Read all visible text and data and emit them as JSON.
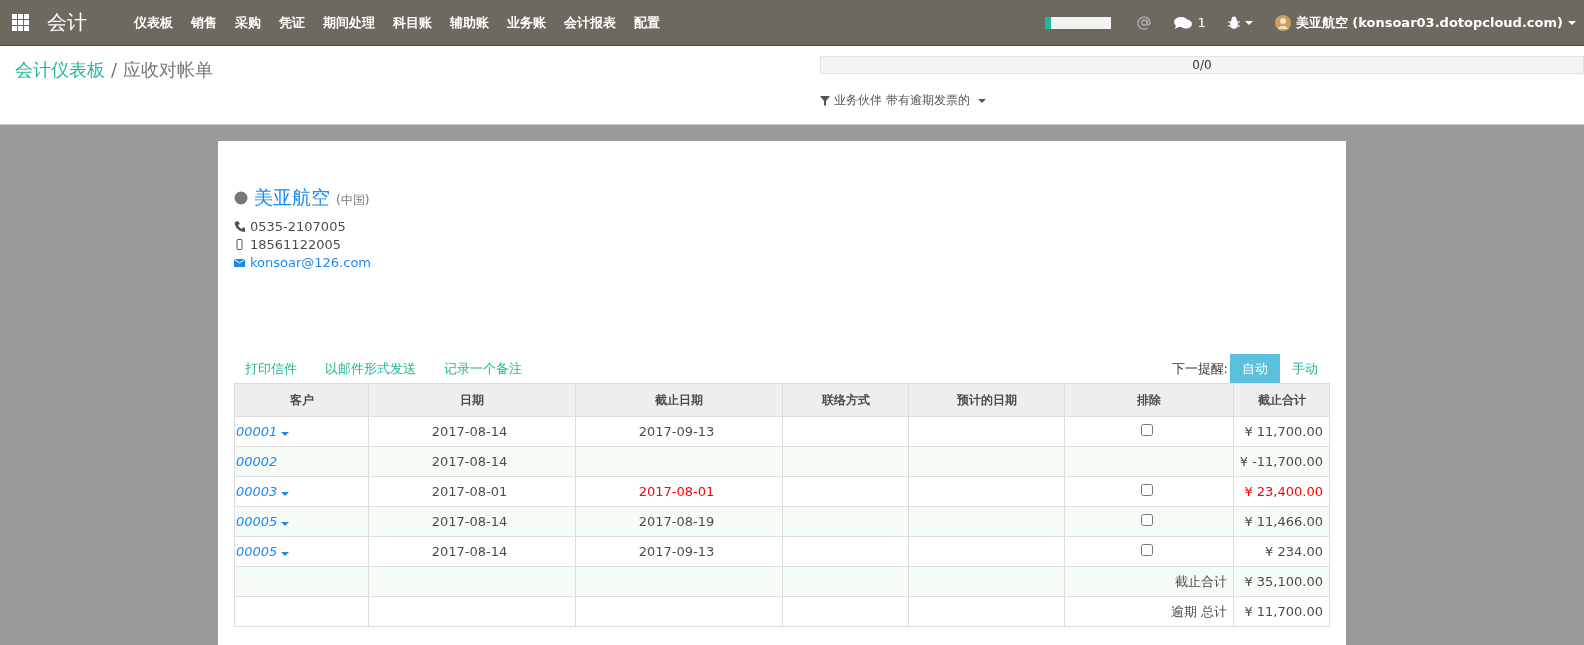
{
  "navbar": {
    "app_title": "会计",
    "menu": [
      "仪表板",
      "销售",
      "采购",
      "凭证",
      "期间处理",
      "科目账",
      "辅助账",
      "业务账",
      "会计报表",
      "配置"
    ],
    "progress": {
      "level": 0.08
    },
    "chat_count": "1",
    "user": "美亚航空 (konsoar03.dotopcloud.com)"
  },
  "breadcrumb": {
    "parent": "会计仪表板",
    "separator": "/",
    "current": "应收对帐单"
  },
  "pager": "0/0",
  "filter": "业务伙伴 带有逾期发票的",
  "partner": {
    "name": "美亚航空",
    "country": "(中国)",
    "phone": "0535-2107005",
    "mobile": "18561122005",
    "email": "konsoar@126.com"
  },
  "actions": [
    "打印信件",
    "以邮件形式发送",
    "记录一个备注"
  ],
  "reminder": {
    "label": "下一提醒:",
    "options": [
      {
        "label": "自动",
        "selected": true
      },
      {
        "label": "手动",
        "selected": false
      }
    ]
  },
  "table": {
    "columns": [
      "客户",
      "日期",
      "截止日期",
      "联络方式",
      "预计的日期",
      "排除",
      "截止合计"
    ],
    "rows": [
      {
        "kind": "invoice",
        "number": "00001",
        "date": "2017-08-14",
        "due_date": "2017-09-13",
        "overdue": false,
        "excluded": false,
        "total": "¥ 11,700.00"
      },
      {
        "kind": "payment",
        "number": "00002",
        "date": "2017-08-14",
        "total": "¥ -11,700.00"
      },
      {
        "kind": "invoice",
        "number": "00003",
        "date": "2017-08-01",
        "due_date": "2017-08-01",
        "overdue": true,
        "excluded": false,
        "total": "¥ 23,400.00"
      },
      {
        "kind": "invoice",
        "number": "00005",
        "date": "2017-08-14",
        "due_date": "2017-08-19",
        "overdue": false,
        "excluded": false,
        "total": "¥ 11,466.00"
      },
      {
        "kind": "invoice",
        "number": "00005",
        "date": "2017-08-14",
        "due_date": "2017-09-13",
        "overdue": false,
        "excluded": false,
        "total": "¥ 234.00"
      }
    ],
    "summary": [
      {
        "label": "截止合计",
        "value": "¥ 35,100.00"
      },
      {
        "label": "逾期 总计",
        "value": "¥ 11,700.00"
      }
    ]
  }
}
